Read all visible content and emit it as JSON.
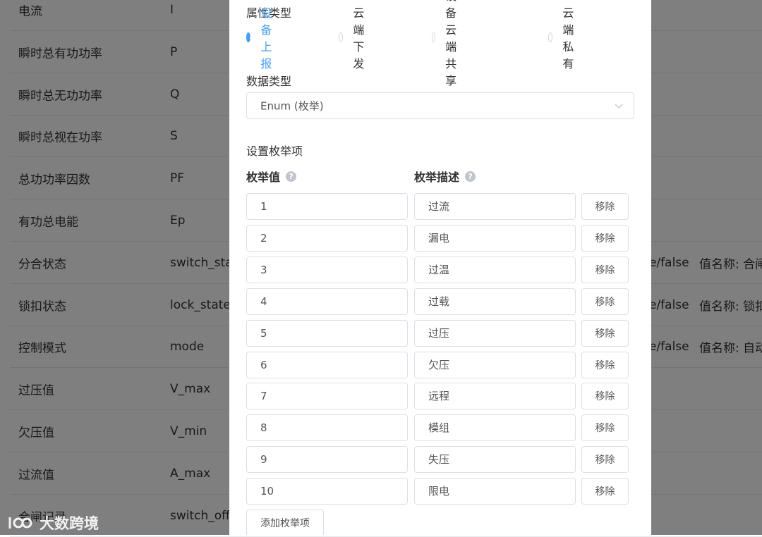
{
  "background_table": {
    "rows": [
      {
        "name": "电流",
        "id": "I",
        "extra1": "",
        "extra2": ""
      },
      {
        "name": "瞬时总有功功率",
        "id": "P",
        "extra1": "",
        "extra2": ""
      },
      {
        "name": "瞬时总无功功率",
        "id": "Q",
        "extra1": "",
        "extra2": ""
      },
      {
        "name": "瞬时总视在功率",
        "id": "S",
        "extra1": "",
        "extra2": ""
      },
      {
        "name": "总功功率因数",
        "id": "PF",
        "extra1": "",
        "extra2": ""
      },
      {
        "name": "有功总电能",
        "id": "Ep",
        "extra1": "",
        "extra2": ""
      },
      {
        "name": "分合状态",
        "id": "switch_sta",
        "extra1": "e/false",
        "extra2": "值名称: 合闸"
      },
      {
        "name": "锁扣状态",
        "id": "lock_state",
        "extra1": "e/false",
        "extra2": "值名称: 锁扣"
      },
      {
        "name": "控制模式",
        "id": "mode",
        "extra1": "e/false",
        "extra2": "值名称: 自动"
      },
      {
        "name": "过压值",
        "id": "V_max",
        "extra1": "",
        "extra2": ""
      },
      {
        "name": "欠压值",
        "id": "V_min",
        "extra1": "",
        "extra2": ""
      },
      {
        "name": "过流值",
        "id": "A_max",
        "extra1": "",
        "extra2": ""
      },
      {
        "name": "合闸记录",
        "id": "switch_off",
        "extra1": "",
        "extra2": ""
      }
    ]
  },
  "dialog": {
    "attr_type_label": "属性类型",
    "attr_type_options": [
      {
        "label": "设备上报",
        "checked": true
      },
      {
        "label": "云端下发",
        "checked": false
      },
      {
        "label": "设备云端共享",
        "checked": false
      },
      {
        "label": "云端私有",
        "checked": false
      }
    ],
    "data_type_label": "数据类型",
    "data_type_value": "Enum (枚举)",
    "enum_section_label": "设置枚举项",
    "enum_value_header": "枚举值",
    "enum_desc_header": "枚举描述",
    "help_glyph": "?",
    "remove_label": "移除",
    "add_label": "添加枚举项",
    "enum_items": [
      {
        "value": "1",
        "desc": "过流"
      },
      {
        "value": "2",
        "desc": "漏电"
      },
      {
        "value": "3",
        "desc": "过温"
      },
      {
        "value": "4",
        "desc": "过载"
      },
      {
        "value": "5",
        "desc": "过压"
      },
      {
        "value": "6",
        "desc": "欠压"
      },
      {
        "value": "7",
        "desc": "远程"
      },
      {
        "value": "8",
        "desc": "模组"
      },
      {
        "value": "9",
        "desc": "失压"
      },
      {
        "value": "10",
        "desc": "限电"
      }
    ]
  },
  "watermark_text": "大数跨境",
  "colors": {
    "accent": "#409eff",
    "mask": "rgba(0,0,0,0.5)"
  }
}
